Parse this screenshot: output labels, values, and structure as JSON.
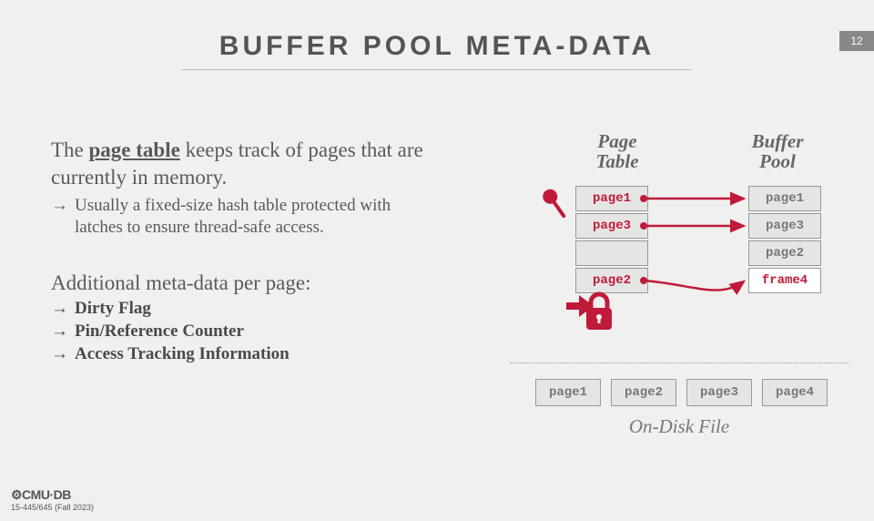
{
  "page_number": "12",
  "title": "BUFFER POOL META-DATA",
  "lead_pre": "The ",
  "lead_keyword": "page table",
  "lead_post": " keeps track of pages that are currently in memory.",
  "sub_arrow": "→",
  "sub_text": "Usually a fixed-size hash table protected with latches to ensure thread-safe access.",
  "section2": "Additional meta-data per page:",
  "meta_items": {
    "0": "Dirty Flag",
    "1": "Pin/Reference Counter",
    "2": "Access Tracking Information"
  },
  "diagram": {
    "page_table_header": "Page Table",
    "buffer_pool_header": "Buffer Pool",
    "page_table_slots": {
      "0": "page1",
      "1": "page3",
      "2": "",
      "3": "page2"
    },
    "buffer_pool_slots": {
      "0": "page1",
      "1": "page3",
      "2": "page2",
      "3": "frame4"
    },
    "disk_pages": {
      "0": "page1",
      "1": "page2",
      "2": "page3",
      "3": "page4"
    },
    "disk_label": "On-Disk File"
  },
  "footer": {
    "logo": "⚙CMU·DB",
    "course": "15-445/645 (Fall 2023)"
  }
}
